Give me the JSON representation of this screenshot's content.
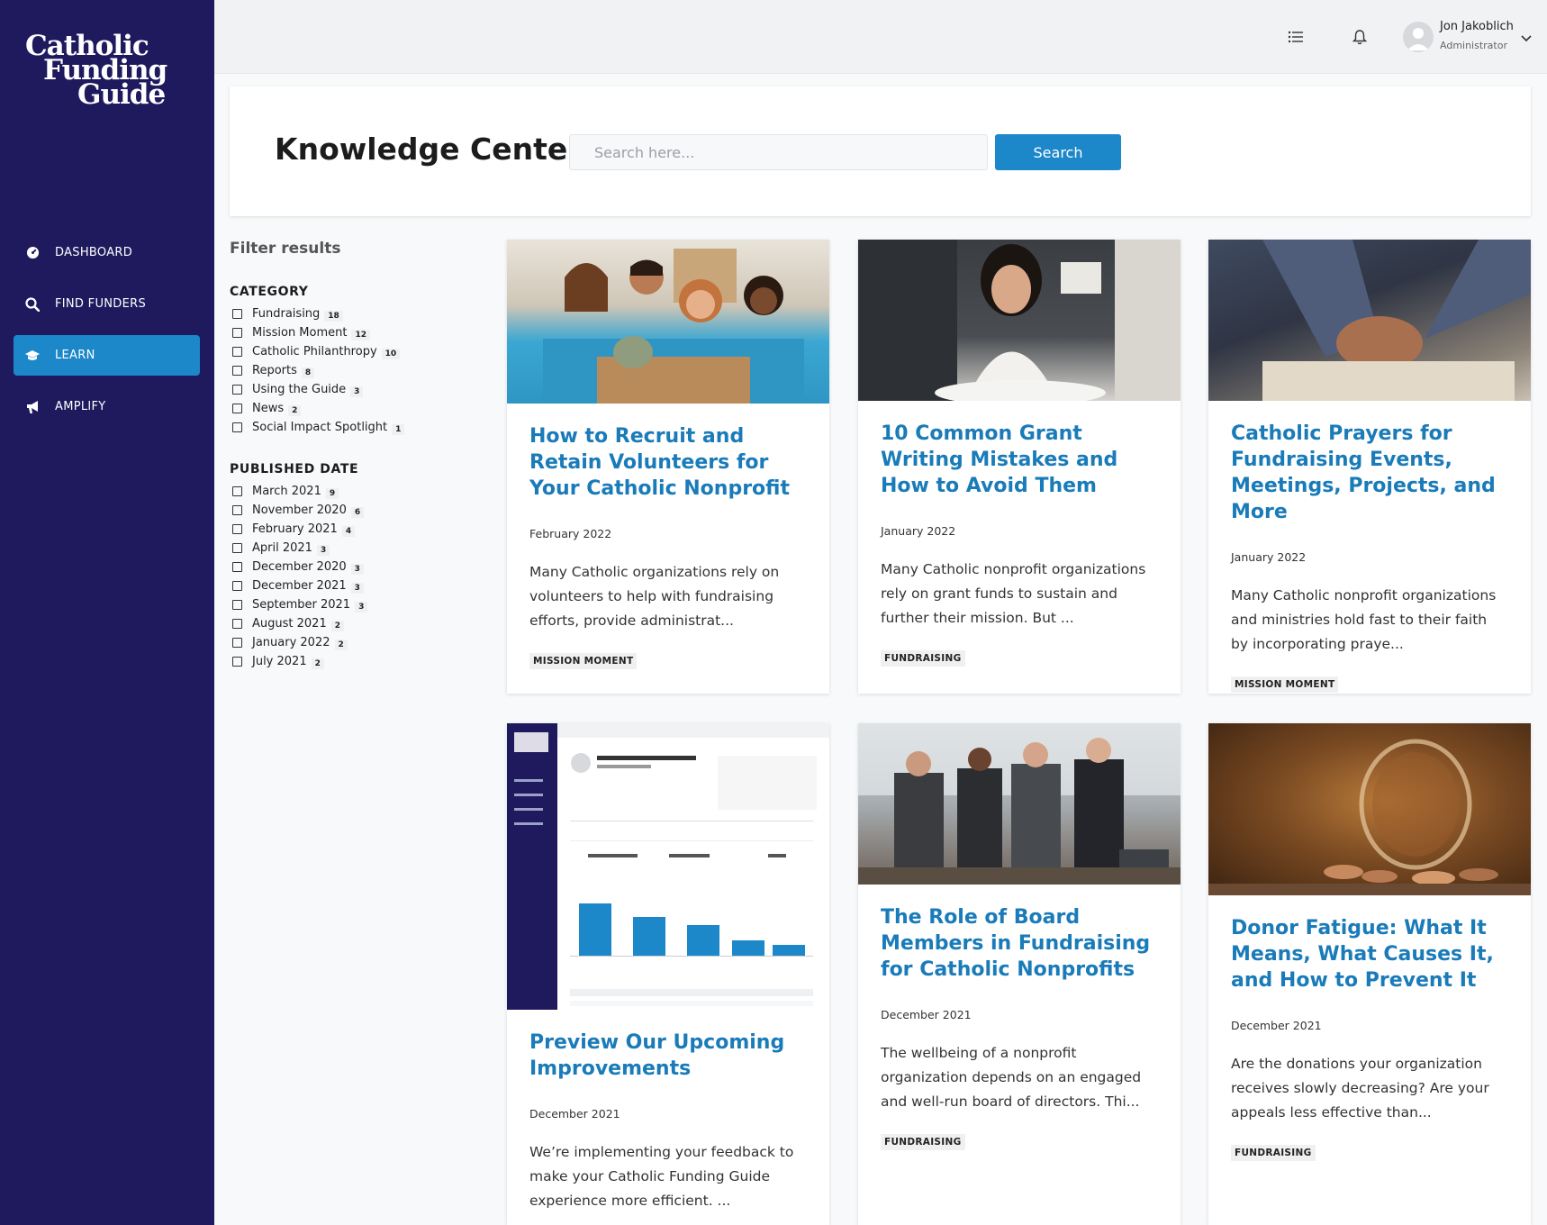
{
  "brand": {
    "line1": "Catholic",
    "line2": "Funding",
    "line3": "Guide"
  },
  "nav": [
    {
      "label": "DASHBOARD",
      "icon": "dashboard-gauge-icon"
    },
    {
      "label": "FIND FUNDERS",
      "icon": "search-icon"
    },
    {
      "label": "LEARN",
      "icon": "graduation-cap-icon",
      "active": true
    },
    {
      "label": "AMPLIFY",
      "icon": "megaphone-icon"
    }
  ],
  "header": {
    "user_name": "Jon Jakoblich",
    "user_role": "Administrator"
  },
  "page": {
    "title": "Knowledge Center",
    "search_placeholder": "Search here...",
    "search_button": "Search"
  },
  "filters": {
    "title": "Filter results",
    "category_title": "CATEGORY",
    "categories": [
      {
        "label": "Fundraising",
        "count": "18"
      },
      {
        "label": "Mission Moment",
        "count": "12"
      },
      {
        "label": "Catholic Philanthropy",
        "count": "10"
      },
      {
        "label": "Reports",
        "count": "8"
      },
      {
        "label": "Using the Guide",
        "count": "3"
      },
      {
        "label": "News",
        "count": "2"
      },
      {
        "label": "Social Impact Spotlight",
        "count": "1"
      }
    ],
    "date_title": "PUBLISHED DATE",
    "dates": [
      {
        "label": "March 2021",
        "count": "9"
      },
      {
        "label": "November 2020",
        "count": "6"
      },
      {
        "label": "February 2021",
        "count": "4"
      },
      {
        "label": "April 2021",
        "count": "3"
      },
      {
        "label": "December 2020",
        "count": "3"
      },
      {
        "label": "December 2021",
        "count": "3"
      },
      {
        "label": "September 2021",
        "count": "3"
      },
      {
        "label": "August 2021",
        "count": "2"
      },
      {
        "label": "January 2022",
        "count": "2"
      },
      {
        "label": "July 2021",
        "count": "2"
      }
    ]
  },
  "articles": [
    {
      "title": "How to Recruit and Retain Volunteers for Your Catholic Nonprofit",
      "date": "February 2022",
      "excerpt": "Many Catholic organizations rely on volunteers to help with fundraising efforts, provide administrat...",
      "tag": "MISSION MOMENT"
    },
    {
      "title": "10 Common Grant Writing Mistakes and How to Avoid Them",
      "date": "January 2022",
      "excerpt": "Many Catholic nonprofit organizations rely on grant funds to sustain and further their mission. But ...",
      "tag": "FUNDRAISING"
    },
    {
      "title": "Catholic Prayers for Fundraising Events, Meetings, Projects, and More",
      "date": "January 2022",
      "excerpt": "Many Catholic nonprofit organizations and ministries hold fast to their faith by incorporating praye...",
      "tag": "MISSION MOMENT"
    },
    {
      "title": "Preview Our Upcoming Improvements",
      "date": "December 2021",
      "excerpt": "We’re implementing your feedback to make your Catholic Funding Guide experience more efficient. ...",
      "tag": ""
    },
    {
      "title": "The Role of Board Members in Fundraising for Catholic Nonprofits",
      "date": "December 2021",
      "excerpt": "The wellbeing of a nonprofit organization depends on an engaged and well-run board of directors. Thi...",
      "tag": "FUNDRAISING"
    },
    {
      "title": "Donor Fatigue: What It Means, What Causes It, and How to Prevent It",
      "date": "December 2021",
      "excerpt": "Are the donations your organization receives slowly decreasing? Are your appeals less effective than...",
      "tag": "FUNDRAISING"
    }
  ],
  "colors": {
    "sidebar": "#1f1a5e",
    "accent": "#1c87c9",
    "link": "#1a7bb9"
  }
}
